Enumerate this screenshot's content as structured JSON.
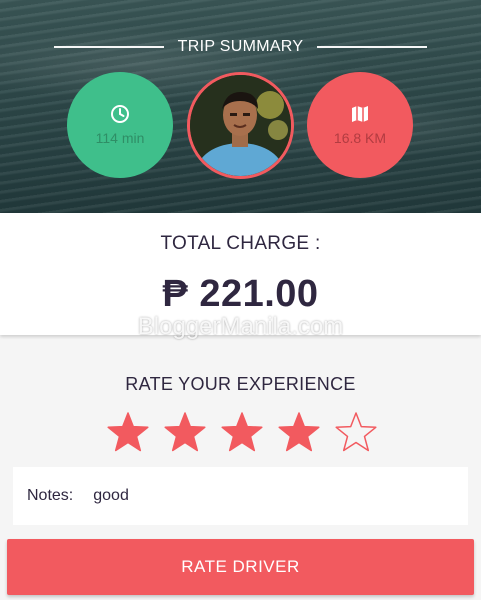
{
  "header": {
    "title": "TRIP SUMMARY",
    "duration": {
      "icon": "clock-icon",
      "value": "114 min"
    },
    "distance": {
      "icon": "map-icon",
      "value": "16.8 KM"
    }
  },
  "charge": {
    "label": "TOTAL CHARGE :",
    "amount": "₱ 221.00"
  },
  "watermark": "BloggerManila.com",
  "rating": {
    "label": "RATE YOUR EXPERIENCE",
    "value": 4,
    "max": 5
  },
  "notes": {
    "label": "Notes:",
    "value": "good"
  },
  "actions": {
    "rate_label": "RATE DRIVER"
  },
  "colors": {
    "accent": "#f25a5f",
    "green": "#3fbf8b",
    "text": "#2f2740"
  }
}
